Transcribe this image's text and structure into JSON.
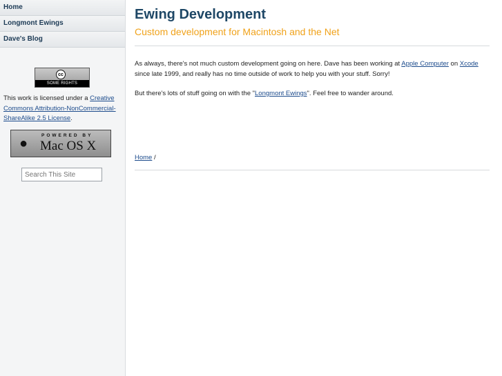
{
  "sidebar": {
    "nav": [
      {
        "label": "Home"
      },
      {
        "label": "Longmont Ewings"
      },
      {
        "label": "Dave's Blog"
      }
    ],
    "cc_badge": {
      "symbol": "cc",
      "text": "SOME RIGHTS RESERVED"
    },
    "license": {
      "prefix": "This work is licensed under a ",
      "link": "Creative Commons Attribution-NonCommercial-ShareAlike 2.5 License",
      "suffix": "."
    },
    "macosx_badge": {
      "powered": "POWERED BY",
      "label": "Mac OS X",
      "icon": "apple-logo-icon"
    },
    "search": {
      "placeholder": "Search This Site",
      "value": ""
    }
  },
  "header": {
    "title": "Ewing Development",
    "tagline": "Custom development for Macintosh and the Net"
  },
  "content": {
    "p1": {
      "text1": "As always, there's not much custom development going on here. Dave has been working at ",
      "link1": "Apple Computer",
      "text2": " on ",
      "link2": "Xcode",
      "text3": " since late 1999, and really has no time outside of work to help you with your stuff. Sorry!"
    },
    "p2": {
      "text1": "But there's lots of stuff going on with the \"",
      "link1": "Longmont Ewings",
      "text2": "\". Feel free to wander around."
    }
  },
  "breadcrumb": {
    "home": "Home",
    "separator": " /"
  },
  "colors": {
    "title": "#1e4766",
    "tagline": "#f0a21a",
    "link": "#1c4b8c",
    "sidebar_bg": "#f4f5f6"
  }
}
